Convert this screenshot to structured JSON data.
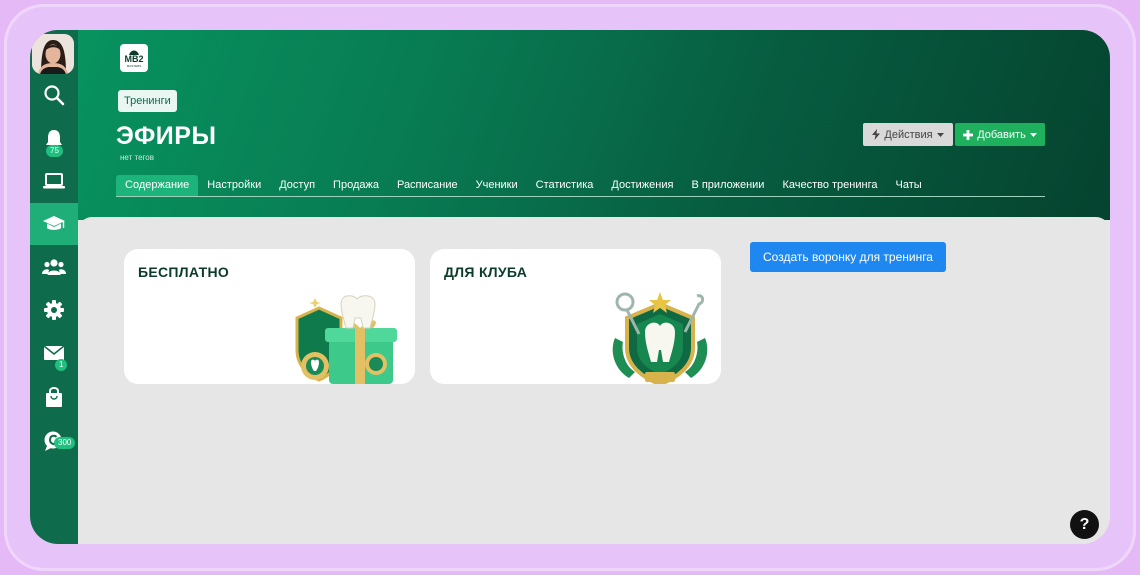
{
  "sidebar": {
    "notifications_badge": "75",
    "mail_badge": "1",
    "chat_badge": "300",
    "items": [
      {
        "icon": "search-icon"
      },
      {
        "icon": "bell-icon"
      },
      {
        "icon": "laptop-icon"
      },
      {
        "icon": "graduation-cap-icon",
        "active": true
      },
      {
        "icon": "users-icon"
      },
      {
        "icon": "gear-icon"
      },
      {
        "icon": "mail-icon"
      },
      {
        "icon": "shopping-bag-icon"
      },
      {
        "icon": "chat-icon"
      }
    ]
  },
  "header": {
    "logo_text": "MB2",
    "logo_sub": "MASTERS",
    "breadcrumb": "Тренинги",
    "title": "ЭФИРЫ",
    "tags": "нет тегов",
    "actions_label": "Действия",
    "add_label": "Добавить"
  },
  "tabs": [
    {
      "label": "Содержание",
      "active": true
    },
    {
      "label": "Настройки"
    },
    {
      "label": "Доступ"
    },
    {
      "label": "Продажа"
    },
    {
      "label": "Расписание"
    },
    {
      "label": "Ученики"
    },
    {
      "label": "Статистика"
    },
    {
      "label": "Достижения"
    },
    {
      "label": "В приложении"
    },
    {
      "label": "Качество тренинга"
    },
    {
      "label": "Чаты"
    }
  ],
  "cards": [
    {
      "title": "БЕСПЛАТНО",
      "art": "gift-tooth-illustration"
    },
    {
      "title": "ДЛЯ КЛУБА",
      "art": "shield-tooth-illustration"
    }
  ],
  "funnel_button": "Создать воронку для тренинга",
  "help_label": "?",
  "colors": {
    "sidebar": "#0e6b4b",
    "accent": "#1fb05e",
    "primary_button": "#1e88f0",
    "frame": "#e4b9f6"
  }
}
